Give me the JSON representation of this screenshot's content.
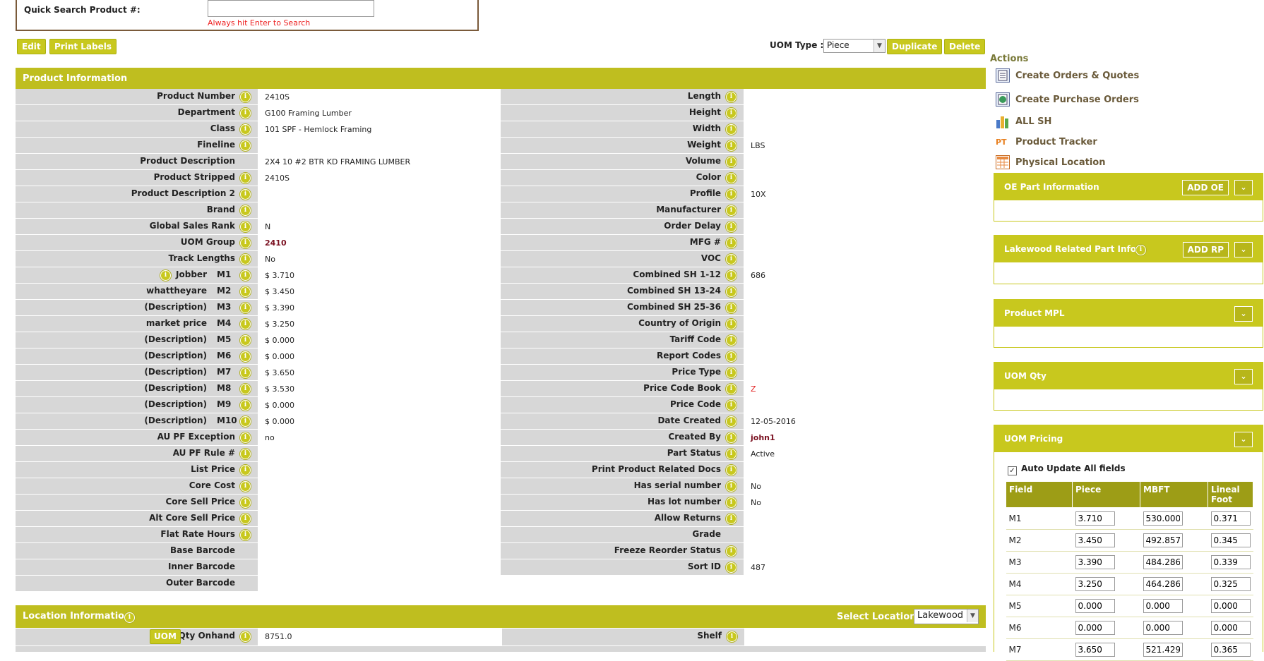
{
  "quick_search": {
    "label": "Quick Search Product #:",
    "value": "",
    "hint": "Always hit Enter to Search"
  },
  "toolbar": {
    "edit": "Edit",
    "print_labels": "Print Labels",
    "uom_type_label": "UOM Type :",
    "uom_type_value": "Piece",
    "duplicate": "Duplicate",
    "delete": "Delete"
  },
  "product_info": {
    "title": "Product Information",
    "left": [
      {
        "label": "Product Number",
        "value": "2410S"
      },
      {
        "label": "Department",
        "value": "G100 Framing Lumber"
      },
      {
        "label": "Class",
        "value": "101 SPF - Hemlock Framing"
      },
      {
        "label": "Fineline",
        "value": ""
      },
      {
        "label": "Product Description",
        "value": "2X4 10 #2 BTR KD FRAMING LUMBER"
      },
      {
        "label": "Product Stripped",
        "value": "2410S"
      },
      {
        "label": "Product Description 2",
        "value": ""
      },
      {
        "label": "Brand",
        "value": ""
      },
      {
        "label": "Global Sales Rank",
        "value": "N"
      },
      {
        "label": "UOM Group",
        "value": "2410"
      },
      {
        "label": "Track Lengths",
        "value": "No"
      },
      {
        "label": "Jobber",
        "code": "M1",
        "value": "$ 3.710"
      },
      {
        "label": "whattheyare",
        "code": "M2",
        "value": "$ 3.450"
      },
      {
        "label": "(Description)",
        "code": "M3",
        "value": "$ 3.390"
      },
      {
        "label": "market price",
        "code": "M4",
        "value": "$ 3.250"
      },
      {
        "label": "(Description)",
        "code": "M5",
        "value": "$ 0.000"
      },
      {
        "label": "(Description)",
        "code": "M6",
        "value": "$ 0.000"
      },
      {
        "label": "(Description)",
        "code": "M7",
        "value": "$ 3.650"
      },
      {
        "label": "(Description)",
        "code": "M8",
        "value": "$ 3.530"
      },
      {
        "label": "(Description)",
        "code": "M9",
        "value": "$ 0.000"
      },
      {
        "label": "(Description)",
        "code": "M10",
        "value": "$ 0.000"
      },
      {
        "label": "AU PF Exception",
        "value": "no"
      },
      {
        "label": "AU PF Rule #",
        "value": ""
      },
      {
        "label": "List Price",
        "value": ""
      },
      {
        "label": "Core Cost",
        "value": ""
      },
      {
        "label": "Core Sell Price",
        "value": ""
      },
      {
        "label": "Alt Core Sell Price",
        "value": ""
      },
      {
        "label": "Flat Rate Hours",
        "value": ""
      },
      {
        "label": "Base Barcode",
        "value": ""
      },
      {
        "label": "Inner Barcode",
        "value": ""
      },
      {
        "label": "Outer Barcode",
        "value": ""
      }
    ],
    "right": [
      {
        "label": "Length",
        "value": ""
      },
      {
        "label": "Height",
        "value": ""
      },
      {
        "label": "Width",
        "value": ""
      },
      {
        "label": "Weight",
        "value": "LBS"
      },
      {
        "label": "Volume",
        "value": ""
      },
      {
        "label": "Color",
        "value": ""
      },
      {
        "label": "Profile",
        "value": "10X"
      },
      {
        "label": "Manufacturer",
        "value": ""
      },
      {
        "label": "Order Delay",
        "value": ""
      },
      {
        "label": "MFG #",
        "value": ""
      },
      {
        "label": "VOC",
        "value": ""
      },
      {
        "label": "Combined SH 1-12",
        "value": "686"
      },
      {
        "label": "Combined SH 13-24",
        "value": ""
      },
      {
        "label": "Combined SH 25-36",
        "value": ""
      },
      {
        "label": "Country of Origin",
        "value": ""
      },
      {
        "label": "Tariff Code",
        "value": ""
      },
      {
        "label": "Report Codes",
        "value": ""
      },
      {
        "label": "Price Type",
        "value": ""
      },
      {
        "label": "Price Code Book",
        "value": "Z"
      },
      {
        "label": "Price Code",
        "value": ""
      },
      {
        "label": "Date Created",
        "value": "12-05-2016"
      },
      {
        "label": "Created By",
        "value": "john1"
      },
      {
        "label": "Part Status",
        "value": "Active"
      },
      {
        "label": "Print Product Related Docs",
        "value": ""
      },
      {
        "label": "Has serial number",
        "value": "No"
      },
      {
        "label": "Has lot number",
        "value": "No"
      },
      {
        "label": "Allow Returns",
        "value": ""
      },
      {
        "label": "Grade",
        "value": ""
      },
      {
        "label": "Freeze Reorder Status",
        "value": ""
      },
      {
        "label": "Sort ID",
        "value": "487"
      }
    ]
  },
  "location_info": {
    "title": "Location Information",
    "select_label": "Select Location:",
    "select_value": "Lakewood",
    "uom_btn": "UOM",
    "qty_label": "Qty Onhand",
    "qty_value": "8751.0",
    "shelf_label": "Shelf",
    "shelf_value": ""
  },
  "actions": {
    "title": "Actions",
    "items": [
      {
        "label": "Create Orders & Quotes",
        "icon": "document-list-icon"
      },
      {
        "label": "Create Purchase Orders",
        "icon": "globe-document-icon"
      },
      {
        "label": "ALL SH",
        "icon": "bar-chart-icon"
      },
      {
        "label": "Product Tracker",
        "icon": "pt-icon",
        "icon_text": "PT"
      },
      {
        "label": "Physical Location",
        "icon": "grid-table-icon"
      }
    ]
  },
  "side_panels": {
    "oe": {
      "title": "OE Part Information",
      "btn": "ADD OE"
    },
    "related": {
      "title": "Lakewood Related Part Info",
      "btn": "ADD RP"
    },
    "mpl": {
      "title": "Product MPL"
    },
    "uom_qty": {
      "title": "UOM Qty"
    },
    "uom_pricing": {
      "title": "UOM Pricing",
      "auto_update": "Auto Update All fields",
      "headers": [
        "Field",
        "Piece",
        "MBFT",
        "Lineal Foot"
      ],
      "rows": [
        {
          "field": "M1",
          "piece": "3.710",
          "mbft": "530.000",
          "lf": "0.371"
        },
        {
          "field": "M2",
          "piece": "3.450",
          "mbft": "492.857",
          "lf": "0.345"
        },
        {
          "field": "M3",
          "piece": "3.390",
          "mbft": "484.286",
          "lf": "0.339"
        },
        {
          "field": "M4",
          "piece": "3.250",
          "mbft": "464.286",
          "lf": "0.325"
        },
        {
          "field": "M5",
          "piece": "0.000",
          "mbft": "0.000",
          "lf": "0.000"
        },
        {
          "field": "M6",
          "piece": "0.000",
          "mbft": "0.000",
          "lf": "0.000"
        },
        {
          "field": "M7",
          "piece": "3.650",
          "mbft": "521.429",
          "lf": "0.365"
        }
      ]
    }
  },
  "colors": {
    "accent": "#c8c81e",
    "label_bg": "#d7d7d7",
    "uom_group_value": "#7a1020",
    "price_code_book": "#e22222"
  }
}
